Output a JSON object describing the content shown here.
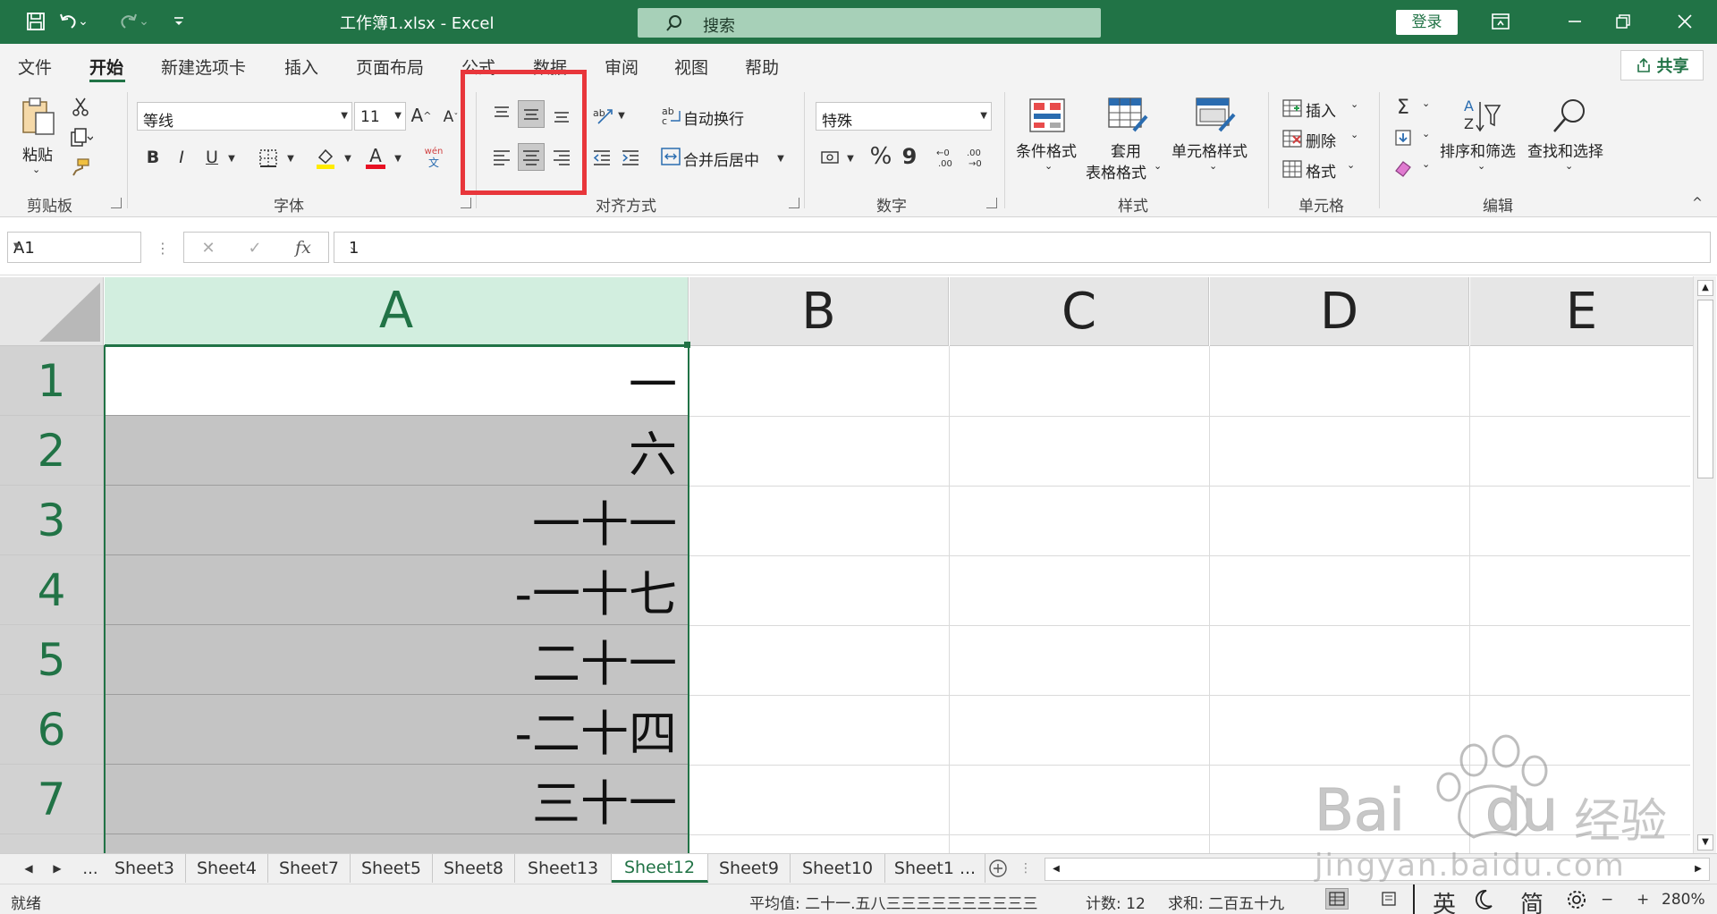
{
  "titlebar": {
    "title": "工作簿1.xlsx  -  Excel",
    "search_label": "搜索",
    "login_label": "登录",
    "icons": [
      "save-icon",
      "undo-icon",
      "redo-icon",
      "customize-icon",
      "search-icon",
      "ribbon-display-icon",
      "minimize-icon",
      "restore-icon",
      "close-icon"
    ]
  },
  "menu": {
    "tabs": [
      "文件",
      "开始",
      "新建选项卡",
      "插入",
      "页面布局",
      "公式",
      "数据",
      "审阅",
      "视图",
      "帮助"
    ],
    "active": "开始",
    "share_label": "共享"
  },
  "ribbon": {
    "clipboard": {
      "paste_label": "粘贴",
      "group_label": "剪贴板"
    },
    "font": {
      "name": "等线",
      "size": "11",
      "group_label": "字体",
      "underline": "U",
      "bold": "B",
      "italic": "I",
      "phonetic_top": "wén",
      "phonetic_bottom": "文",
      "font_color": "#e81123",
      "fill_color": "#ffeb00"
    },
    "alignment": {
      "wrap_label": "自动换行",
      "merge_label": "合并后居中",
      "group_label": "对齐方式",
      "pressed": [
        "middle-align",
        "center-align"
      ]
    },
    "number": {
      "format": "特殊",
      "percent": "%",
      "comma": "9",
      "group_label": "数字"
    },
    "styles": {
      "conditional_label": "条件格式",
      "table_label_1": "套用",
      "table_label_2": "表格格式",
      "cell_style_label": "单元格样式",
      "group_label": "样式"
    },
    "cells": {
      "insert_label": "插入",
      "delete_label": "删除",
      "format_label": "格式",
      "group_label": "单元格"
    },
    "editing": {
      "sort_label": "排序和筛选",
      "find_label": "查找和选择",
      "group_label": "编辑"
    }
  },
  "formula_bar": {
    "name_box": "A1",
    "cancel": "✕",
    "confirm": "✓",
    "fx": "fx",
    "value": "1"
  },
  "grid": {
    "columns": [
      "A",
      "B",
      "C",
      "D",
      "E"
    ],
    "selected_column": "A",
    "rows": [
      {
        "num": "1",
        "a": "一"
      },
      {
        "num": "2",
        "a": "六"
      },
      {
        "num": "3",
        "a": "一十一"
      },
      {
        "num": "4",
        "a": "-一十七"
      },
      {
        "num": "5",
        "a": "二十一"
      },
      {
        "num": "6",
        "a": "-二十四"
      },
      {
        "num": "7",
        "a": "三十一"
      }
    ]
  },
  "sheets": {
    "tabs": [
      "Sheet3",
      "Sheet4",
      "Sheet7",
      "Sheet5",
      "Sheet8",
      "Sheet13",
      "Sheet12",
      "Sheet9",
      "Sheet10",
      "Sheet1 ..."
    ],
    "active": "Sheet12",
    "more": "..."
  },
  "status": {
    "ready": "就绪",
    "average": "平均值: 二十一.五八三三三三三三三三三三",
    "count": "计数: 12",
    "sum": "求和: 二百五十九",
    "ime_lang": "英",
    "ime_mode": "简",
    "zoom": "280%",
    "zoom_minus": "−",
    "zoom_plus": "+"
  },
  "watermark": {
    "text": "jingyan.baidu.com",
    "logo_text": "Bai",
    "logo_text2": "du",
    "logo_text3": "经验"
  },
  "colors": {
    "accent": "#217346",
    "highlight": "#e8363b",
    "selection_fill": "#c4c4c4"
  }
}
